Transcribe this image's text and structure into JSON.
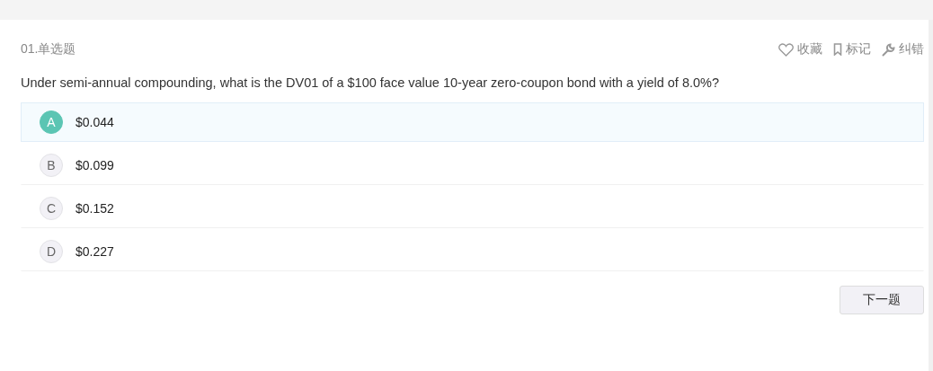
{
  "question": {
    "number": "01.单选题",
    "text": "Under semi-annual compounding, what is the DV01 of a $100 face value 10-year zero-coupon bond with a yield of 8.0%?"
  },
  "actions": [
    {
      "kind": "favorite",
      "label": "收藏"
    },
    {
      "kind": "mark",
      "label": "标记"
    },
    {
      "kind": "report",
      "label": "纠错"
    }
  ],
  "options": [
    {
      "letter": "A",
      "text": "$0.044",
      "selected": true
    },
    {
      "letter": "B",
      "text": "$0.099",
      "selected": false
    },
    {
      "letter": "C",
      "text": "$0.152",
      "selected": false
    },
    {
      "letter": "D",
      "text": "$0.227",
      "selected": false
    }
  ],
  "next_button": "下一题"
}
